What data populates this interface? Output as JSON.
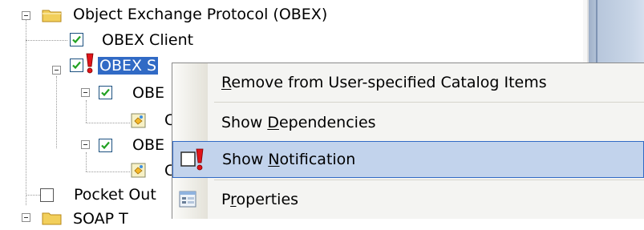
{
  "tree": {
    "items": [
      {
        "label": "Object Exchange Protocol (OBEX)",
        "icon": "folder-icon",
        "expanded": true
      },
      {
        "label": "OBEX Client",
        "checked": true
      },
      {
        "label": "OBEX S",
        "checked": true,
        "warning": true,
        "selected": true,
        "expanded": true
      },
      {
        "label": "OBE",
        "checked": true,
        "expanded": true
      },
      {
        "label": "C",
        "icon": "component-icon"
      },
      {
        "label": "OBE",
        "checked": true,
        "expanded": true
      },
      {
        "label": "C",
        "icon": "component-icon"
      },
      {
        "label": "Pocket Out",
        "checked": false
      },
      {
        "label": "SOAP T",
        "icon": "folder-icon",
        "partial": true
      }
    ]
  },
  "context_menu": {
    "items": [
      {
        "pre": "",
        "key": "R",
        "post": "emove from User-specified Catalog Items",
        "icon": ""
      },
      {
        "pre": "Show ",
        "key": "D",
        "post": "ependencies",
        "icon": ""
      },
      {
        "pre": "Show ",
        "key": "N",
        "post": "otification",
        "icon": "notification-warning-icon",
        "highlighted": true
      },
      {
        "pre": "P",
        "key": "r",
        "post": "operties",
        "icon": "properties-icon"
      }
    ]
  },
  "colors": {
    "selection": "#316ac5",
    "menu_highlight": "#c2d3ec",
    "warning_red": "#e0141a",
    "folder_yellow": "#f2cf5b"
  }
}
